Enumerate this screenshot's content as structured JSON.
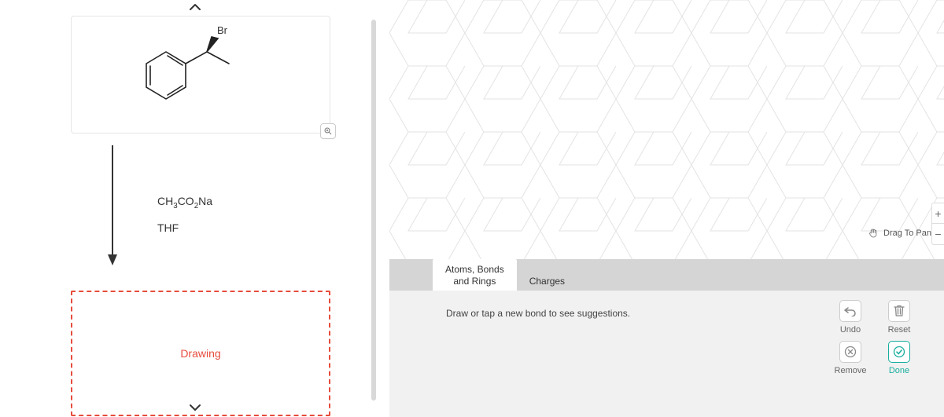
{
  "left": {
    "molecule_label": "Br",
    "reagent1_html": "CH3CO2Na",
    "reagent2": "THF",
    "drawing_label": "Drawing"
  },
  "canvas": {
    "pan_label": "Drag To Pan"
  },
  "tabs": {
    "atoms": "Atoms, Bonds\nand Rings",
    "charges": "Charges"
  },
  "tooltip": {
    "hint": "Draw or tap a new bond to see suggestions."
  },
  "actions": {
    "undo": "Undo",
    "reset": "Reset",
    "remove": "Remove",
    "done": "Done"
  },
  "zoom": {
    "plus": "+",
    "minus": "−"
  }
}
